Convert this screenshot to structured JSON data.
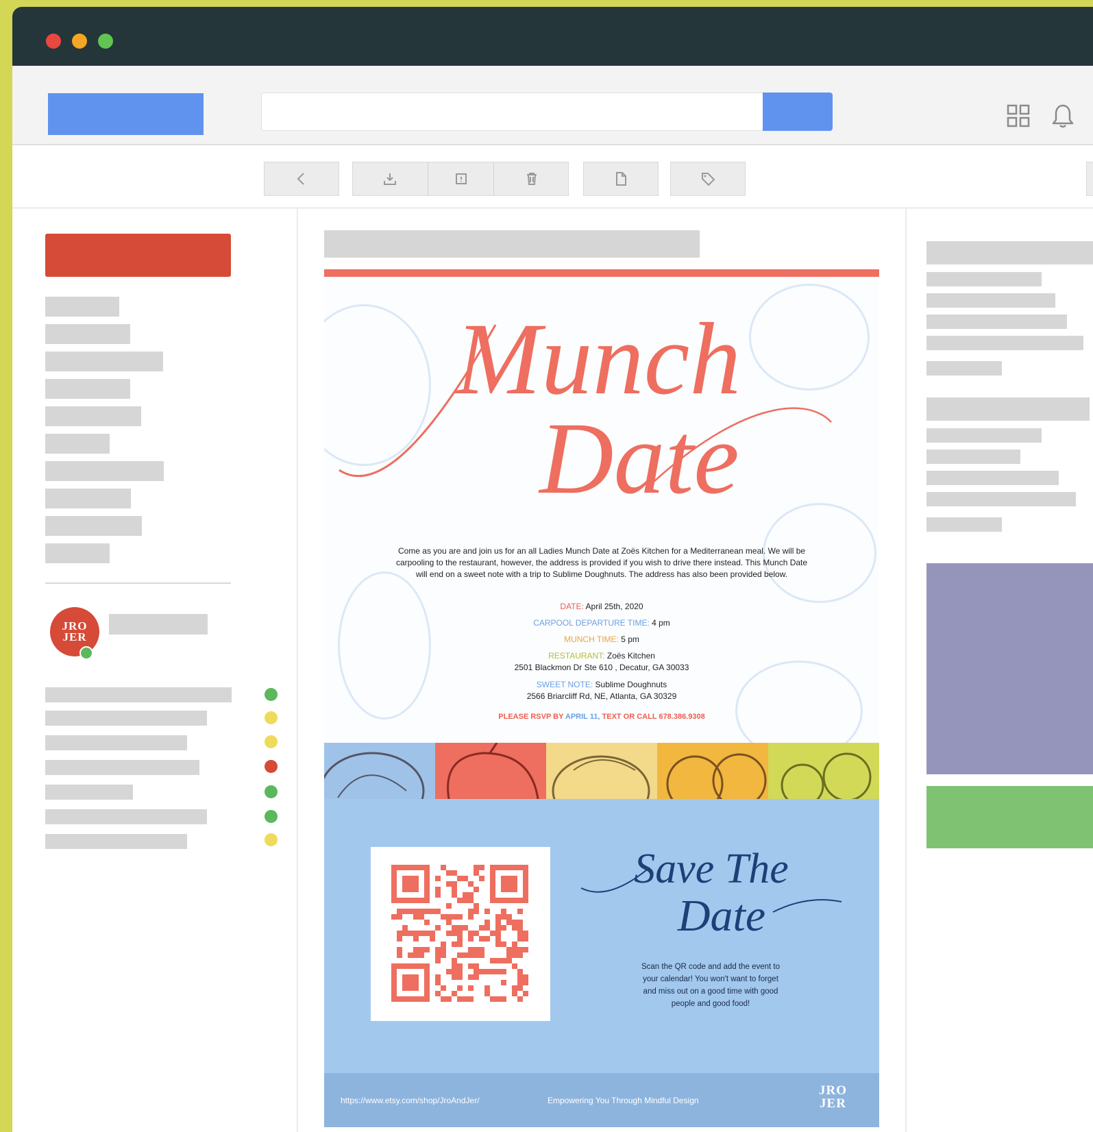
{
  "window": {
    "controls": [
      "close",
      "minimize",
      "maximize"
    ],
    "control_colors": {
      "close": "#e8483f",
      "minimize": "#f5a623",
      "maximize": "#61c554"
    }
  },
  "header": {
    "search_placeholder": "",
    "icons": [
      "apps-grid-icon",
      "bell-icon"
    ]
  },
  "toolbar": {
    "buttons": [
      "back",
      "archive",
      "report-spam",
      "delete",
      "move-to",
      "labels"
    ]
  },
  "sidebar": {
    "avatar_text_line1": "JRO",
    "avatar_text_line2": "JER",
    "status_dot_colors": [
      "#5bb85d",
      "#eedb5b",
      "#eedb5b",
      "#d64a38",
      "#5bb85d",
      "#5bb85d",
      "#eedb5b"
    ]
  },
  "email": {
    "invite": {
      "title_line1": "Munch",
      "title_line2": "Date",
      "body": "Come as you are and join us for an all Ladies Munch Date at Zoës Kitchen for a Mediterranean meal. We will be carpooling to the restaurant, however, the address is provided if you wish to drive there instead. This Munch Date will end on a sweet note with a trip to Sublime Doughnuts. The address has also been provided below.",
      "date_label": "DATE:",
      "date_value": "April 25th, 2020",
      "carpool_label": "CARPOOL DEPARTURE TIME:",
      "carpool_value": "4 pm",
      "munch_label": "MUNCH TIME:",
      "munch_value": "5 pm",
      "restaurant_label": "RESTAURANT:",
      "restaurant_name": "Zoës Kitchen",
      "restaurant_address": "2501 Blackmon Dr Ste 610 , Decatur, GA 30033",
      "sweet_label": "SWEET NOTE:",
      "sweet_name": "Sublime Doughnuts",
      "sweet_address": "2566 Briarcliff Rd, NE, Atlanta, GA 30329",
      "rsvp_prefix": "PLEASE RSVP BY",
      "rsvp_date": "APRIL 11,",
      "rsvp_suffix": "TEXT OR CALL 678.386.9308"
    },
    "strip_colors": [
      "#9fc3e8",
      "#ee6e5f",
      "#f3d98a",
      "#f1b73e",
      "#d2d957"
    ],
    "save_the_date": {
      "title_line1": "Save The",
      "title_line2": "Date",
      "text": "Scan the QR code and add the event to your calendar! You won't want to forget and miss out on a good time with good people and good food!"
    },
    "footer": {
      "url": "https://www.etsy.com/shop/JroAndJer/",
      "tagline": "Empowering You Through Mindful Design",
      "logo_line1": "JRO",
      "logo_line2": "JER"
    }
  }
}
